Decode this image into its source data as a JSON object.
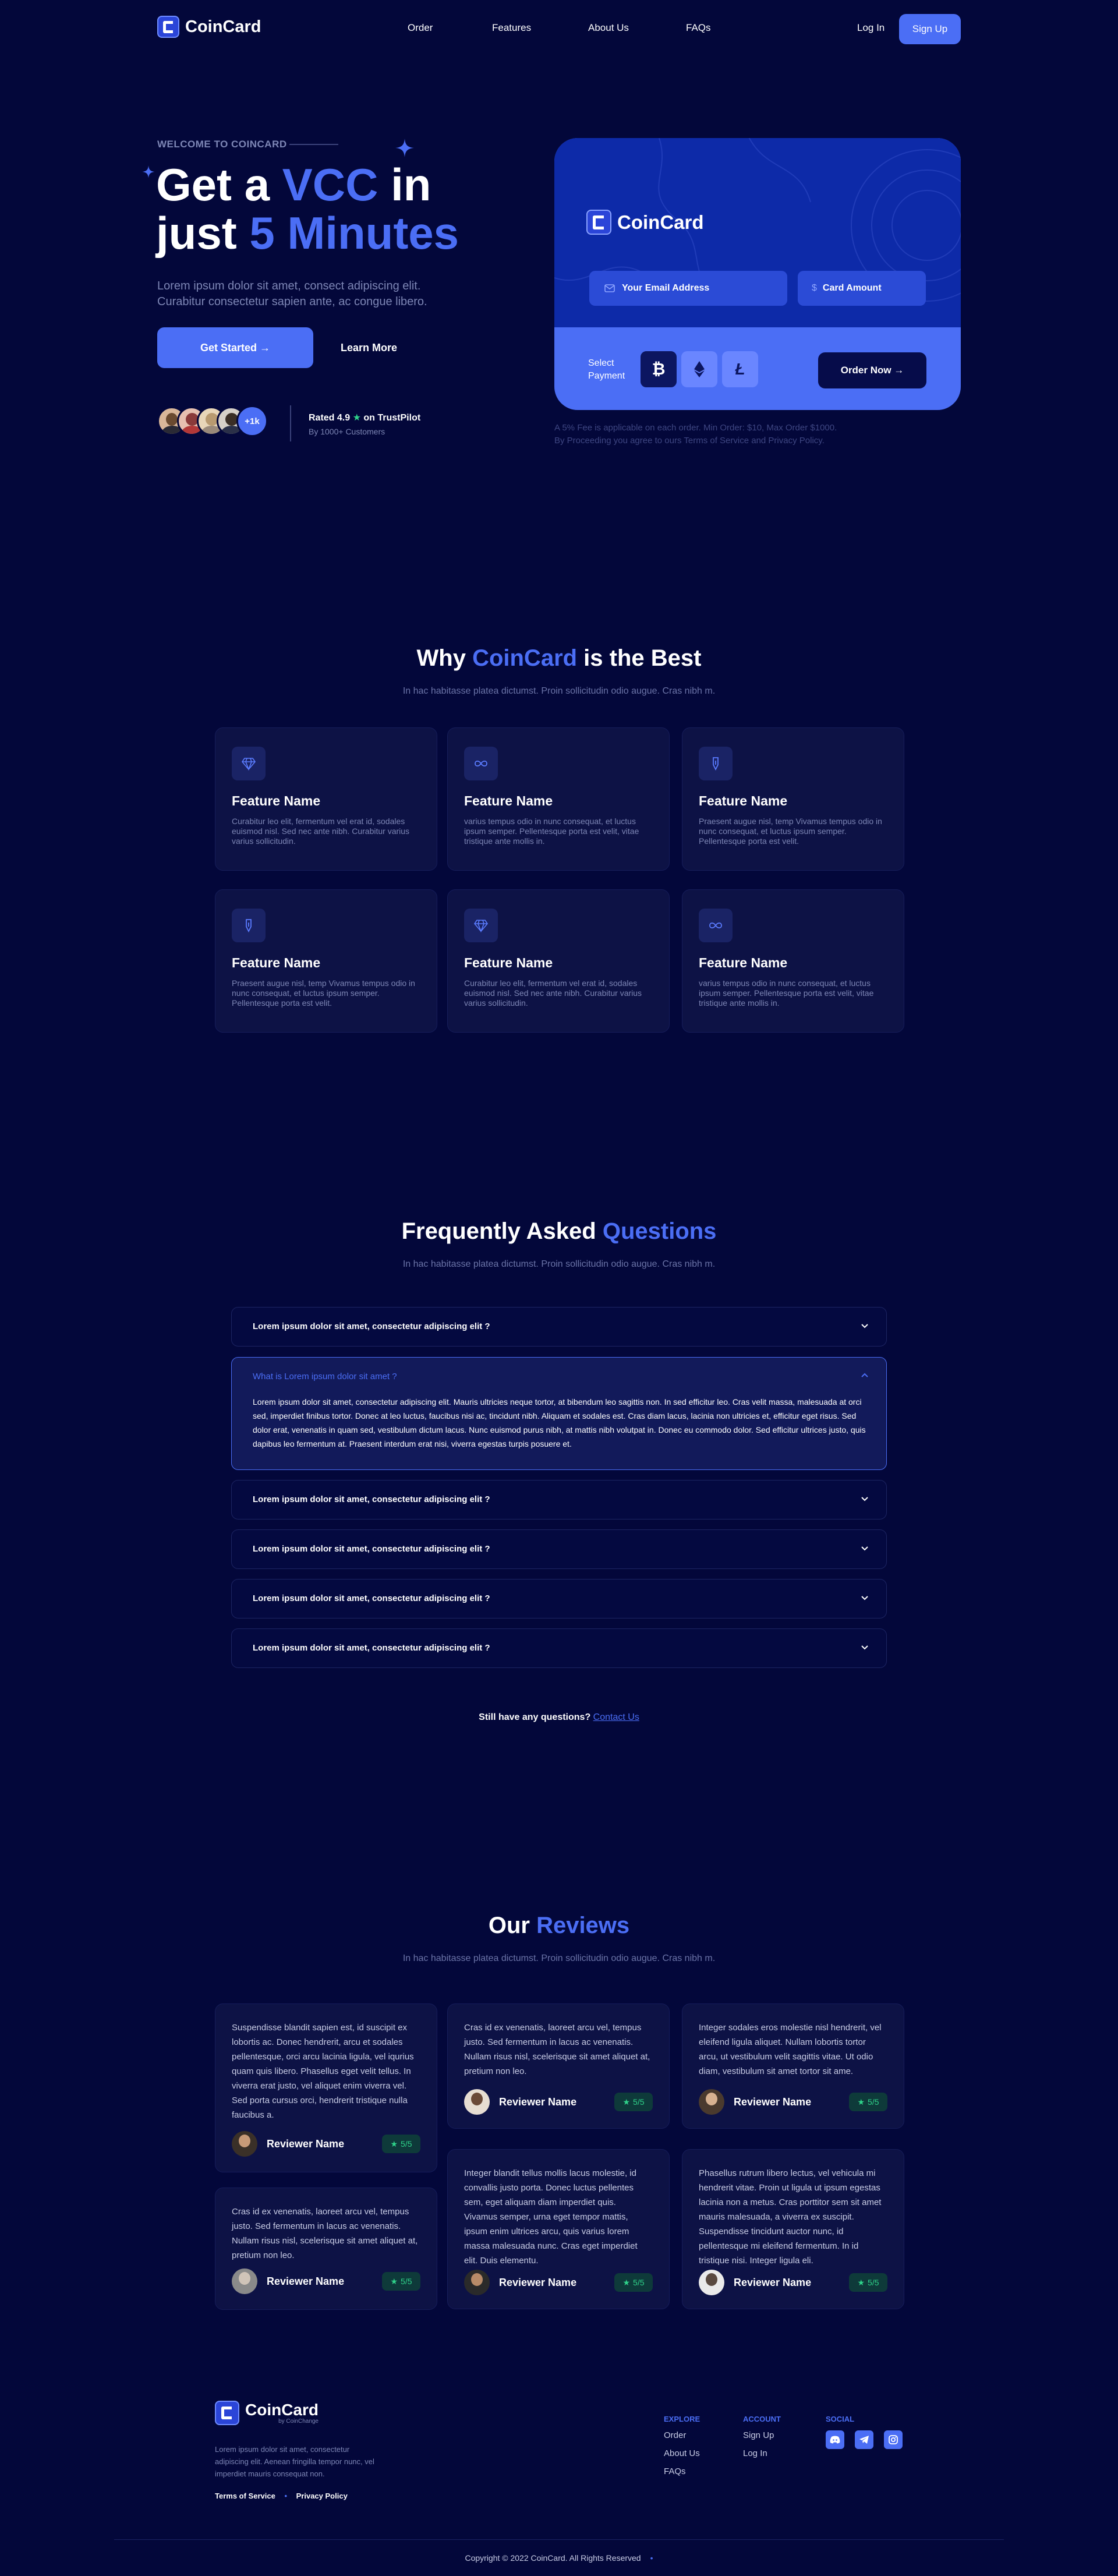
{
  "brand": {
    "name": "CoinCard",
    "tagline": "by CoinChange"
  },
  "nav": {
    "links": [
      "Order",
      "Features",
      "About Us",
      "FAQs"
    ],
    "login": "Log In",
    "signup": "Sign Up"
  },
  "hero": {
    "eyebrow": "WELCOME TO COINCARD",
    "line1a": "Get a ",
    "line1b": "VCC",
    "line1c": " in",
    "line2a": "just ",
    "line2b": "5 Minutes",
    "desc1": "Lorem ipsum dolor sit amet, consect adipiscing elit.",
    "desc2": "Curabitur consectetur sapien ante, ac congue libero.",
    "cta": "Get Started →",
    "learn": "Learn More",
    "avatar_more": "+1k",
    "rating": "Rated 4.9",
    "trustpilot": "on TrustPilot",
    "customers": "By 1000+ Customers"
  },
  "order": {
    "email_ph": "Your Email Address",
    "amount_ph": "Card Amount",
    "select": "Select Payment",
    "order_btn": "Order Now →",
    "note1": "A 5% Fee is applicable on each order. Min Order: $10, Max Order $1000.",
    "note2": "By Proceeding you agree to ours Terms of Service and Privacy Policy.",
    "coins": [
      "bitcoin-icon",
      "ethereum-icon",
      "litecoin-icon"
    ]
  },
  "why": {
    "title_a": "Why ",
    "title_b": "CoinCard",
    "title_c": " is the Best",
    "sub": "In hac habitasse platea dictumst. Proin sollicitudin odio augue. Cras nibh m.",
    "features": [
      {
        "icon": "diamond-icon",
        "title": "Feature Name",
        "desc": "Curabitur leo elit, fermentum vel erat id, sodales euismod nisl. Sed nec ante nibh. Curabitur varius varius sollicitudin."
      },
      {
        "icon": "infinity-icon",
        "title": "Feature Name",
        "desc": "varius tempus odio in nunc consequat, et luctus ipsum semper. Pellentesque porta est velit, vitae tristique ante mollis in."
      },
      {
        "icon": "pen-icon",
        "title": "Feature Name",
        "desc": "Praesent augue nisl, temp Vivamus tempus odio in nunc consequat, et luctus ipsum semper. Pellentesque porta est velit."
      },
      {
        "icon": "pen-icon",
        "title": "Feature Name",
        "desc": "Praesent augue nisl, temp Vivamus tempus odio in nunc consequat, et luctus ipsum semper. Pellentesque porta est velit."
      },
      {
        "icon": "diamond-icon",
        "title": "Feature Name",
        "desc": "Curabitur leo elit, fermentum vel erat id, sodales euismod nisl. Sed nec ante nibh. Curabitur varius varius sollicitudin."
      },
      {
        "icon": "infinity-icon",
        "title": "Feature Name",
        "desc": "varius tempus odio in nunc consequat, et luctus ipsum semper. Pellentesque porta est velit, vitae tristique ante mollis in."
      }
    ]
  },
  "faq": {
    "title_a": "Frequently Asked ",
    "title_b": "Questions",
    "sub": "In hac habitasse platea dictumst. Proin sollicitudin odio augue. Cras nibh m.",
    "items": [
      "Lorem ipsum dolor sit amet, consectetur adipiscing elit ?",
      "What is Lorem ipsum dolor sit amet ?",
      "Lorem ipsum dolor sit amet, consectetur adipiscing elit ?",
      "Lorem ipsum dolor sit amet, consectetur adipiscing elit ?",
      "Lorem ipsum dolor sit amet, consectetur adipiscing elit ?",
      "Lorem ipsum dolor sit amet, consectetur adipiscing elit ?"
    ],
    "answer": "Lorem ipsum dolor sit amet, consectetur adipiscing elit. Mauris ultricies neque tortor, at bibendum leo sagittis non. In sed efficitur leo. Cras velit massa, malesuada at orci sed, imperdiet finibus tortor. Donec at leo luctus, faucibus nisi ac, tincidunt nibh. Aliquam et sodales est. Cras diam lacus, lacinia non ultricies et, efficitur eget risus. Sed dolor erat, venenatis in quam sed, vestibulum dictum lacus. Nunc euismod purus nibh, at mattis nibh volutpat in. Donec eu commodo dolor. Sed efficitur ultrices justo, quis dapibus leo fermentum at. Praesent interdum erat nisi, viverra egestas turpis posuere et.",
    "still": "Still have any questions?",
    "contact": "Contact Us"
  },
  "reviews": {
    "title_a": "Our ",
    "title_b": "Reviews",
    "sub": "In hac habitasse platea dictumst. Proin sollicitudin odio augue. Cras nibh m.",
    "items": [
      {
        "text": "Suspendisse blandit sapien est, id suscipit ex lobortis ac. Donec hendrerit, arcu et sodales pellentesque, orci arcu lacinia ligula, vel iqurius quam quis libero. Phasellus eget velit tellus. In viverra erat justo, vel aliquet enim viverra vel. Sed porta cursus orci, hendrerit tristique nulla faucibus a.",
        "name": "Reviewer Name",
        "score": "5/5"
      },
      {
        "text": "Cras id ex venenatis, laoreet arcu vel, tempus justo. Sed fermentum in lacus ac venenatis. Nullam risus nisl, scelerisque sit amet aliquet at, pretium non leo.",
        "name": "Reviewer Name",
        "score": "5/5"
      },
      {
        "text": "Integer sodales eros molestie nisl hendrerit, vel eleifend ligula aliquet. Nullam lobortis tortor arcu, ut vestibulum velit sagittis vitae. Ut odio diam, vestibulum sit amet tortor sit ame.",
        "name": "Reviewer Name",
        "score": "5/5"
      },
      {
        "text": "Cras id ex venenatis, laoreet arcu vel, tempus justo. Sed fermentum in lacus ac venenatis. Nullam risus nisl, scelerisque sit amet aliquet at, pretium non leo.",
        "name": "Reviewer Name",
        "score": "5/5"
      },
      {
        "text": "Integer blandit tellus mollis lacus molestie, id convallis justo porta. Donec luctus pellentes sem, eget aliquam diam imperdiet quis. Vivamus semper, urna eget tempor mattis, ipsum enim ultrices arcu, quis varius lorem massa malesuada nunc. Cras eget imperdiet elit. Duis elementu.",
        "name": "Reviewer Name",
        "score": "5/5"
      },
      {
        "text": "Phasellus rutrum libero lectus, vel vehicula mi hendrerit vitae. Proin ut ligula ut ipsum egestas lacinia non a metus. Cras porttitor sem sit amet mauris malesuada, a viverra ex suscipit. Suspendisse tincidunt auctor nunc, id pellentesque mi eleifend fermentum. In id tristique nisi. Integer ligula eli.",
        "name": "Reviewer Name",
        "score": "5/5"
      }
    ]
  },
  "footer": {
    "desc": "Lorem ipsum dolor sit amet, consectetur adipiscing elit. Aenean fringilla tempor nunc, vel imperdiet mauris consequat non.",
    "terms": "Terms of Service",
    "privacy": "Privacy Policy",
    "explore_h": "EXPLORE",
    "explore": [
      "Order",
      "About Us",
      "FAQs"
    ],
    "account_h": "ACCOUNT",
    "account": [
      "Sign Up",
      "Log In"
    ],
    "social_h": "SOCIAL",
    "social": [
      "discord-icon",
      "telegram-icon",
      "instagram-icon"
    ],
    "copyright": "Copyright © 2022 CoinCard. All Rights Reserved"
  },
  "colors": {
    "bg": "#03073a",
    "accent": "#4b6ef5",
    "card": "#0d1245",
    "green": "#2fd38a"
  }
}
